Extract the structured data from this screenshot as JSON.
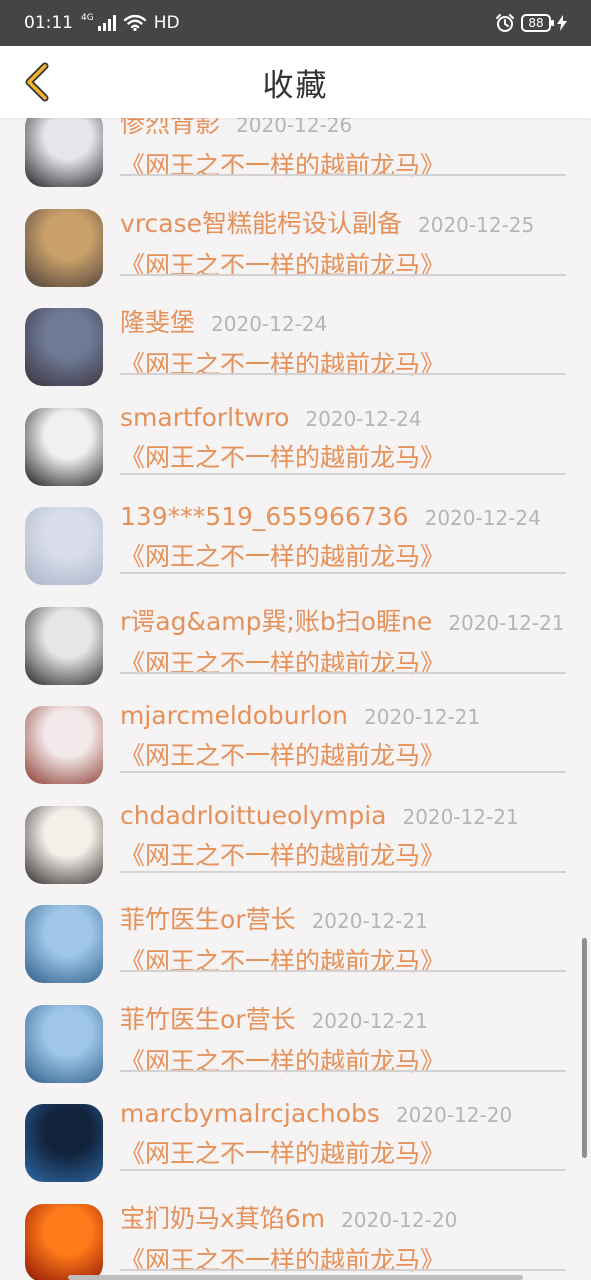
{
  "status_bar": {
    "time": "01:11",
    "network": "4G",
    "hd": "HD",
    "battery": "88"
  },
  "header": {
    "title": "收藏",
    "back_icon": "chevron-left-icon",
    "accent": "#f2b32c"
  },
  "items": [
    {
      "name": "惨烈背影",
      "date": "2020-12-26",
      "book": "《网王之不一样的越前龙马》",
      "avatar_colors": [
        "#e8e4ec",
        "#1e1c24"
      ]
    },
    {
      "name": "vrcase智糕能枵设认副备",
      "date": "2020-12-25",
      "book": "《网王之不一样的越前龙马》",
      "avatar_colors": [
        "#c9a06a",
        "#4a3d38"
      ]
    },
    {
      "name": "隆斐堡",
      "date": "2020-12-24",
      "book": "《网王之不一样的越前龙马》",
      "avatar_colors": [
        "#6e7a96",
        "#3a2f3a"
      ]
    },
    {
      "name": "smartforltwro",
      "date": "2020-12-24",
      "book": "《网王之不一样的越前龙马》",
      "avatar_colors": [
        "#f0f0f0",
        "#1a1a1a"
      ]
    },
    {
      "name": "139***519_655966736",
      "date": "2020-12-24",
      "book": "《网王之不一样的越前龙马》",
      "avatar_colors": [
        "#d8dde9",
        "#aab3c9"
      ]
    },
    {
      "name": "r谔ag&amp巽;账b扫o睚ne",
      "date": "2020-12-21",
      "book": "《网王之不一样的越前龙马》",
      "avatar_colors": [
        "#e6e6e6",
        "#222222"
      ]
    },
    {
      "name": "mjarcmeldoburlon",
      "date": "2020-12-21",
      "book": "《网王之不一样的越前龙马》",
      "avatar_colors": [
        "#f3e9ea",
        "#8a3a2e"
      ]
    },
    {
      "name": "chdadrloittueolympia",
      "date": "2020-12-21",
      "book": "《网王之不一样的越前龙马》",
      "avatar_colors": [
        "#f4efe9",
        "#2e2a26"
      ]
    },
    {
      "name": "菲竹医生or营长",
      "date": "2020-12-21",
      "book": "《网王之不一样的越前龙马》",
      "avatar_colors": [
        "#9fc6e8",
        "#2d5d8a"
      ]
    },
    {
      "name": "菲竹医生or营长",
      "date": "2020-12-21",
      "book": "《网王之不一样的越前龙马》",
      "avatar_colors": [
        "#9fc6e8",
        "#2d5d8a"
      ]
    },
    {
      "name": "marcbymalrcjachobs",
      "date": "2020-12-20",
      "book": "《网王之不一样的越前龙马》",
      "avatar_colors": [
        "#12233c",
        "#2f6aa8"
      ]
    },
    {
      "name": "宝扪奶马x萁馅6m",
      "date": "2020-12-20",
      "book": "《网王之不一样的越前龙马》",
      "avatar_colors": [
        "#ff7a1a",
        "#8a1205"
      ]
    }
  ]
}
